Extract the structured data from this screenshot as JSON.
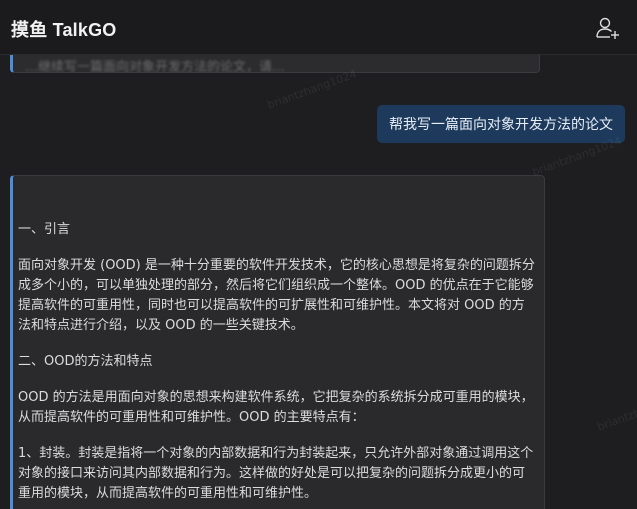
{
  "header": {
    "title": "摸鱼 TalkGO",
    "add_user_icon": "add-user-icon"
  },
  "chat": {
    "previous_message_fragment": "…继续写一篇面向对象开发方法的论文，请…",
    "user_message": "帮我写一篇面向对象开发方法的论文",
    "assistant_paragraphs": [
      "一、引言",
      "面向对象开发 (OOD) 是一种十分重要的软件开发技术，它的核心思想是将复杂的问题拆分成多个小的，可以单独处理的部分，然后将它们组织成一个整体。OOD 的优点在于它能够提高软件的可重用性，同时也可以提高软件的可扩展性和可维护性。本文将对 OOD 的方法和特点进行介绍，以及 OOD 的一些关键技术。",
      "二、OOD的方法和特点",
      "OOD 的方法是用面向对象的思想来构建软件系统，它把复杂的系统拆分成可重用的模块，从而提高软件的可重用性和可维护性。OOD 的主要特点有：",
      "1、封装。封装是指将一个对象的内部数据和行为封装起来，只允许外部对象通过调用这个对象的接口来访问其内部数据和行为。这样做的好处是可以把复杂的问题拆分成更小的可重用的模块，从而提高软件的可重用性和可维护性。"
    ]
  },
  "watermark": "briantzhang1024"
}
